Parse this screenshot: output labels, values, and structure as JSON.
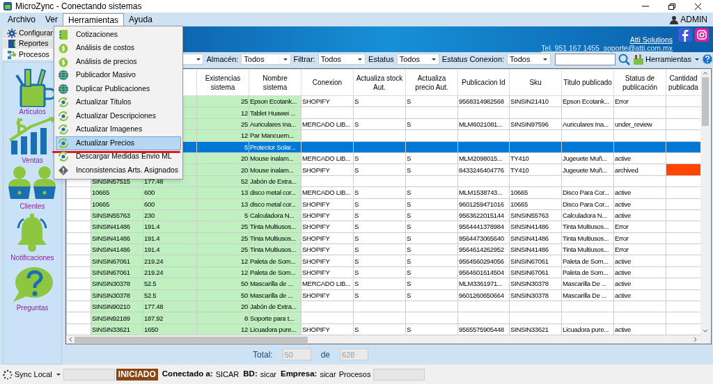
{
  "window": {
    "title": "MicroZync - Conectando sistemas"
  },
  "menu_bar": [
    {
      "label": "Archivo",
      "selected": false
    },
    {
      "label": "Ver",
      "selected": false
    },
    {
      "label": "Herramientas",
      "selected": true
    },
    {
      "label": "Ayuda",
      "selected": false
    }
  ],
  "user": "ADMIN",
  "dropdown_menu": [
    {
      "label": "Cotizaciones",
      "kind": "notebook",
      "selected": false
    },
    {
      "label": "Análisis de costos",
      "kind": "money",
      "selected": false
    },
    {
      "label": "Análisis de precios",
      "kind": "money",
      "selected": false
    },
    {
      "label": "Publicador Masivo",
      "kind": "globe",
      "selected": false
    },
    {
      "label": "Duplicar Publicaciones",
      "kind": "globe",
      "selected": false
    },
    {
      "label": "Actualizar Titulos",
      "kind": "sync",
      "selected": false
    },
    {
      "label": "Actualizar Descripciones",
      "kind": "sync",
      "selected": false
    },
    {
      "label": "Actualizar Imagenes",
      "kind": "sync",
      "selected": false
    },
    {
      "label": "Actualizar Precios",
      "kind": "sync",
      "selected": true
    },
    {
      "label": "Descargar Medidas Envio ML",
      "kind": "sync",
      "selected": false
    },
    {
      "label": "Inconsistencias Arts. Asignados",
      "kind": "warning",
      "selected": false
    }
  ],
  "left_tabs": [
    {
      "label": "Configurar",
      "kind": "gear",
      "selected": false
    },
    {
      "label": "Reportes",
      "kind": "book",
      "selected": false
    },
    {
      "label": "Procesos",
      "kind": "flow",
      "selected": true
    }
  ],
  "sidebar": {
    "items": [
      {
        "label": "Articulos",
        "kind": "supplies"
      },
      {
        "label": "Ventas",
        "kind": "sales"
      },
      {
        "label": "Clientes",
        "kind": "clients"
      },
      {
        "label": "Notificaciones",
        "kind": "bell"
      },
      {
        "label": "Preguntas",
        "kind": "question"
      }
    ]
  },
  "header": {
    "company_link": "Atti Solutions",
    "contact": "Tel. 951 167 1455  soporte@atti.com.mx"
  },
  "toolbar": {
    "filters": [
      {
        "label": "Almacén:",
        "value": "Todos"
      },
      {
        "label": "Filtrar:",
        "value": "Todos"
      },
      {
        "label": "Estatus",
        "value": "Todos"
      },
      {
        "label": "Estatus Conexion:",
        "value": "Todos"
      }
    ],
    "tools_button": "Herramientas"
  },
  "table": {
    "columns": [
      "Existencias sistema",
      "Nombre sistema",
      "Conexion",
      "Actualiza stock Aut.",
      "Actualiza precio Aut.",
      "Publicacion Id",
      "Sku",
      "Titulo publicado",
      "Status de publicación",
      "Cantidad publicada"
    ],
    "rows": [
      {
        "selected": false,
        "existencias": "25",
        "nombre": "Epson Ecotank...",
        "conexion": "SHOPIFY",
        "stock": "S",
        "precio": "S",
        "publicacion_id": "9568314982568",
        "sku": "SINSIN21410",
        "titulo": "Epson Ecotank...",
        "status": "Error"
      },
      {
        "selected": false,
        "existencias": "12",
        "nombre": "Tablet Huawei ..."
      },
      {
        "selected": false,
        "existencias": "25",
        "nombre": "Auriculares Ina...",
        "conexion": "MERCADO LIB...",
        "stock": "S",
        "precio": "S",
        "publicacion_id": "MLM6021081...",
        "sku": "SINSIN97596",
        "titulo": "Auriculares Ina...",
        "status": "under_review"
      },
      {
        "selected": false,
        "existencias": "12",
        "nombre": "Par Mancuern..."
      },
      {
        "selected": true,
        "existencias": "5",
        "nombre": "Protector Solar..."
      },
      {
        "selected": false,
        "existencias": "20",
        "nombre": "Mouse inalam...",
        "conexion": "MERCADO LIB...",
        "stock": "S",
        "precio": "S",
        "publicacion_id": "MLM2098015...",
        "sku": "TY410",
        "titulo": "Jugeuete Muñ...",
        "status": "active"
      },
      {
        "selected": false,
        "existencias": "20",
        "nombre": "Mouse inalam...",
        "conexion": "SHOPIFY",
        "stock": "S",
        "precio": "S",
        "publicacion_id": "8433246404776",
        "sku": "TY410",
        "titulo": "Jugeuete Muñ...",
        "status": "archived",
        "color": "#ff4500"
      },
      {
        "selected": false,
        "column_1": "SINSIN57515",
        "column_2": "177.48",
        "existencias": "52",
        "nombre": "Jabón de Extra..."
      },
      {
        "selected": false,
        "column_1": "10665",
        "column_2": "600",
        "existencias": "13",
        "nombre": "disco metal cor...",
        "conexion": "MERCADO LIB...",
        "stock": "S",
        "precio": "S",
        "publicacion_id": "MLM1538743...",
        "sku": "10665",
        "titulo": "Disco Para Cor...",
        "status": "active"
      },
      {
        "selected": false,
        "column_1": "10665",
        "column_2": "600",
        "existencias": "13",
        "nombre": "disco metal cor...",
        "conexion": "SHOPIFY",
        "stock": "S",
        "precio": "S",
        "publicacion_id": "9601259471016",
        "sku": "10665",
        "titulo": "Disco Para Cor...",
        "status": "active"
      },
      {
        "selected": false,
        "column_1": "SINSIN55763",
        "column_2": "230",
        "existencias": "5",
        "nombre": "Calculadora N...",
        "conexion": "SHOPIFY",
        "stock": "S",
        "precio": "S",
        "publicacion_id": "9563622015144",
        "sku": "SINSIN55763",
        "titulo": "Calculadora N...",
        "status": "active"
      },
      {
        "selected": false,
        "column_1": "SINSIN41486",
        "column_2": "191.4",
        "existencias": "25",
        "nombre": "Tinta Multiusos...",
        "conexion": "SHOPIFY",
        "stock": "S",
        "precio": "S",
        "publicacion_id": "9564441378984",
        "sku": "SINSIN41486",
        "titulo": "Tinta Multiusos...",
        "status": "Error"
      },
      {
        "selected": false,
        "column_1": "SINSIN41486",
        "column_2": "191.4",
        "existencias": "25",
        "nombre": "Tinta Multiusos...",
        "conexion": "SHOPIFY",
        "stock": "S",
        "precio": "S",
        "publicacion_id": "9564473065640",
        "sku": "SINSIN41486",
        "titulo": "Tinta Multiusos...",
        "status": "Error"
      },
      {
        "selected": false,
        "column_1": "SINSIN41486",
        "column_2": "191.4",
        "existencias": "25",
        "nombre": "Tinta Multiusos...",
        "conexion": "SHOPIFY",
        "stock": "S",
        "precio": "S",
        "publicacion_id": "9564614262952",
        "sku": "SINSIN41486",
        "titulo": "Tinta Multiusos...",
        "status": "Error"
      },
      {
        "selected": false,
        "column_1": "SINSIN67061",
        "column_2": "219.24",
        "existencias": "12",
        "nombre": "Paleta de Som...",
        "conexion": "SHOPIFY",
        "stock": "S",
        "precio": "S",
        "publicacion_id": "9564560294056",
        "sku": "SINSIN67061",
        "titulo": "Paleta de Som...",
        "status": "active"
      },
      {
        "selected": false,
        "column_1": "SINSIN67061",
        "column_2": "219.24",
        "existencias": "12",
        "nombre": "Paleta de Som...",
        "conexion": "SHOPIFY",
        "stock": "S",
        "precio": "S",
        "publicacion_id": "9564601614504",
        "sku": "SINSIN67061",
        "titulo": "Paleta de Som...",
        "status": "active"
      },
      {
        "selected": false,
        "column_1": "SINSIN30378",
        "column_2": "52.5",
        "existencias": "50",
        "nombre": "Mascarilla de ...",
        "conexion": "MERCADO LIB...",
        "stock": "S",
        "precio": "S",
        "publicacion_id": "MLM3361971...",
        "sku": "SINSIN30378",
        "titulo": "Mascarilla De ...",
        "status": "active"
      },
      {
        "selected": false,
        "column_1": "SINSIN30378",
        "column_2": "52.5",
        "existencias": "50",
        "nombre": "Mascarilla de ...",
        "conexion": "SHOPIFY",
        "stock": "S",
        "precio": "S",
        "publicacion_id": "9601260650664",
        "sku": "SINSIN30378",
        "titulo": "Mascarilla De ...",
        "status": "active"
      },
      {
        "selected": false,
        "column_1": "SINSIN90210",
        "column_2": "177.48",
        "existencias": "20",
        "nombre": "Jabón de Extra..."
      },
      {
        "selected": false,
        "column_1": "SINSIN92189",
        "column_2": "187.92",
        "existencias": "8",
        "nombre": "Soporte para t..."
      },
      {
        "selected": false,
        "column_1": "SINSIN33621",
        "column_2": "1650",
        "existencias": "12",
        "nombre": "Licuadora pure...",
        "conexion": "SHOPIFY",
        "stock": "S",
        "precio": "S",
        "publicacion_id": "9565575905448",
        "sku": "SINSIN33621",
        "titulo": "Licuadora pure...",
        "status": "active"
      }
    ]
  },
  "totals": {
    "label": "Total:",
    "shown": "50",
    "separator": "de",
    "total": "628"
  },
  "status_bar": {
    "sync": "Sync Local",
    "state": "INICIADO",
    "items": [
      {
        "label": "Conectado a:",
        "value": "SICAR"
      },
      {
        "label": "BD:",
        "value": "sicar"
      },
      {
        "label": "Empresa:",
        "value": "sicar"
      }
    ],
    "process_label": "Procesos"
  }
}
